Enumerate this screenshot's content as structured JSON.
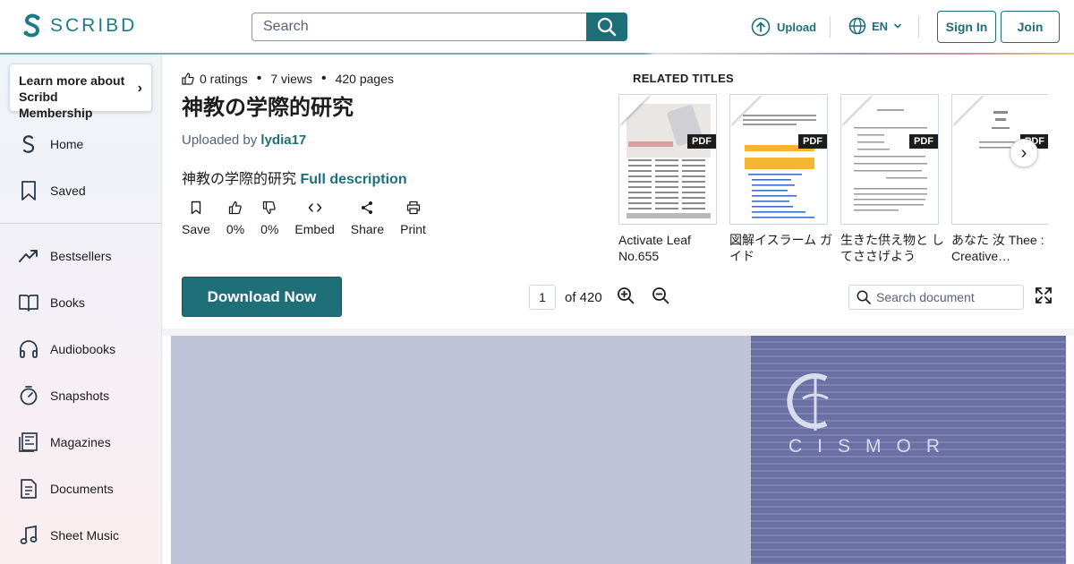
{
  "header": {
    "logo_text": "SCRIBD",
    "search_placeholder": "Search",
    "upload_label": "Upload",
    "language_label": "EN",
    "sign_in_label": "Sign In",
    "join_label": "Join",
    "brand_color": "#1e6f78"
  },
  "sidebar": {
    "membership_label": "Learn more about Scribd Membership",
    "items": [
      {
        "label": "Home",
        "icon": "scribd-home-icon"
      },
      {
        "label": "Saved",
        "icon": "bookmark-icon"
      },
      {
        "label": "Bestsellers",
        "icon": "trending-icon"
      },
      {
        "label": "Books",
        "icon": "book-icon"
      },
      {
        "label": "Audiobooks",
        "icon": "headphones-icon"
      },
      {
        "label": "Snapshots",
        "icon": "stopwatch-icon"
      },
      {
        "label": "Magazines",
        "icon": "magazine-icon"
      },
      {
        "label": "Documents",
        "icon": "document-icon"
      },
      {
        "label": "Sheet Music",
        "icon": "music-note-icon"
      }
    ]
  },
  "document": {
    "ratings": "0 ratings",
    "views": "7 views",
    "pages": "420 pages",
    "title": "神教の学際的研究",
    "uploaded_by_prefix": "Uploaded by",
    "uploader": "lydia17",
    "description": "神教の学際的研究",
    "full_description_label": "Full description",
    "actions": [
      {
        "label": "Save",
        "icon": "bookmark-icon"
      },
      {
        "label": "0%",
        "icon": "thumbs-up-icon"
      },
      {
        "label": "0%",
        "icon": "thumbs-down-icon"
      },
      {
        "label": "Embed",
        "icon": "code-icon"
      },
      {
        "label": "Share",
        "icon": "share-icon"
      },
      {
        "label": "Print",
        "icon": "print-icon"
      }
    ],
    "download_label": "Download Now",
    "current_page": "1",
    "of_pages": "of 420",
    "doc_search_placeholder": "Search document",
    "page_logo_text": "CISMOR"
  },
  "related": {
    "heading": "RELATED TITLES",
    "badge": "PDF",
    "items": [
      {
        "title": "Activate Leaf No.655"
      },
      {
        "title": "図解イスラーム ガイド"
      },
      {
        "title": "生きた供え物と してささげよう"
      },
      {
        "title": "あなた 汝 Thee : Creative…"
      }
    ]
  }
}
